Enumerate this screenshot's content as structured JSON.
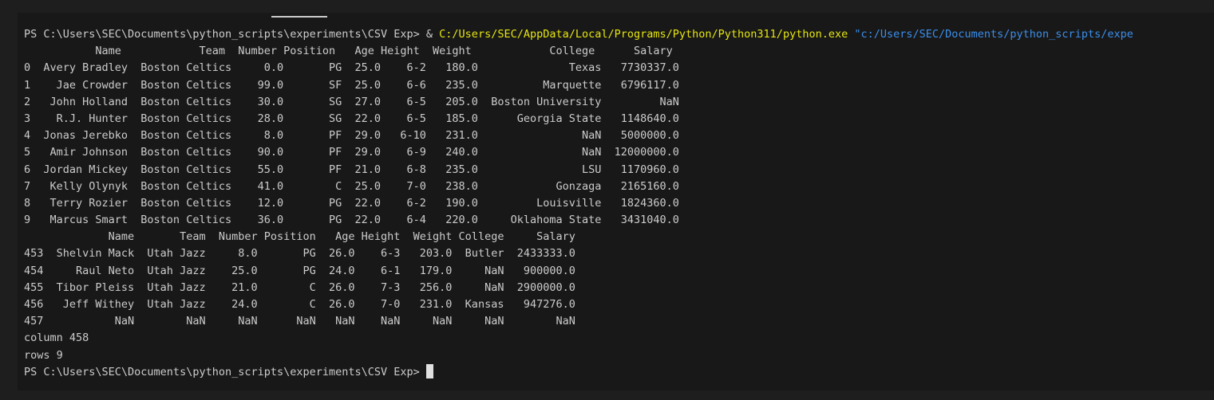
{
  "terminal": {
    "first_prompt": "PS C:\\Users\\SEC\\Documents\\python_scripts\\experiments\\CSV Exp> & ",
    "command_exe": "C:/Users/SEC/AppData/Local/Programs/Python/Python311/python.exe",
    "command_arg": " \"c:/Users/SEC/Documents/python_scripts/expe",
    "table1_lines": [
      "           Name            Team  Number Position   Age Height  Weight            College      Salary",
      "0  Avery Bradley  Boston Celtics     0.0       PG  25.0    6-2   180.0              Texas   7730337.0",
      "1    Jae Crowder  Boston Celtics    99.0       SF  25.0    6-6   235.0          Marquette   6796117.0",
      "2   John Holland  Boston Celtics    30.0       SG  27.0    6-5   205.0  Boston University         NaN",
      "3    R.J. Hunter  Boston Celtics    28.0       SG  22.0    6-5   185.0      Georgia State   1148640.0",
      "4  Jonas Jerebko  Boston Celtics     8.0       PF  29.0   6-10   231.0                NaN   5000000.0",
      "5   Amir Johnson  Boston Celtics    90.0       PF  29.0    6-9   240.0                NaN  12000000.0",
      "6  Jordan Mickey  Boston Celtics    55.0       PF  21.0    6-8   235.0                LSU   1170960.0",
      "7   Kelly Olynyk  Boston Celtics    41.0        C  25.0    7-0   238.0            Gonzaga   2165160.0",
      "8   Terry Rozier  Boston Celtics    12.0       PG  22.0    6-2   190.0         Louisville   1824360.0",
      "9   Marcus Smart  Boston Celtics    36.0       PG  22.0    6-4   220.0     Oklahoma State   3431040.0"
    ],
    "table2_lines": [
      "             Name       Team  Number Position   Age Height  Weight College     Salary",
      "453  Shelvin Mack  Utah Jazz     8.0       PG  26.0    6-3   203.0  Butler  2433333.0",
      "454     Raul Neto  Utah Jazz    25.0       PG  24.0    6-1   179.0     NaN   900000.0",
      "455  Tibor Pleiss  Utah Jazz    21.0        C  26.0    7-3   256.0     NaN  2900000.0",
      "456   Jeff Withey  Utah Jazz    24.0        C  26.0    7-0   231.0  Kansas   947276.0",
      "457           NaN        NaN     NaN      NaN   NaN    NaN     NaN     NaN        NaN"
    ],
    "column_line": "column 458",
    "rows_line": "rows 9",
    "final_prompt": "PS C:\\Users\\SEC\\Documents\\python_scripts\\experiments\\CSV Exp> ",
    "colors": {
      "background": "#181818",
      "text": "#cccccc",
      "command": "#e5e510",
      "argument": "#3b8eea"
    }
  }
}
